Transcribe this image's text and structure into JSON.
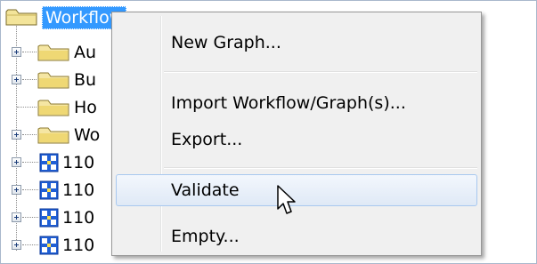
{
  "tree": {
    "root_label": "Workflow",
    "items": [
      {
        "label": "Au",
        "type": "folder",
        "expandable": true
      },
      {
        "label": "Bu",
        "type": "folder",
        "expandable": true
      },
      {
        "label": "Ho",
        "type": "folder",
        "expandable": false
      },
      {
        "label": "Wo",
        "type": "folder",
        "expandable": true
      },
      {
        "label": "110",
        "type": "graph",
        "expandable": true
      },
      {
        "label": "110",
        "type": "graph",
        "expandable": true
      },
      {
        "label": "110",
        "type": "graph",
        "expandable": true
      },
      {
        "label": "110",
        "type": "graph",
        "expandable": true
      }
    ],
    "icons": {
      "folder": "folder-icon",
      "graph": "graph-icon",
      "expander": "plus-expander-icon"
    }
  },
  "context_menu": {
    "items": [
      {
        "label": "New Graph..."
      },
      {
        "label": "Import Workflow/Graph(s)..."
      },
      {
        "label": "Export..."
      },
      {
        "label": "Validate",
        "hovered": true
      },
      {
        "label": "Empty..."
      }
    ]
  },
  "colors": {
    "selection": "#3399ff",
    "menu_background": "#f0f0f0",
    "hover_border": "#a8c8ef",
    "folder_fill": "#f5e6a3",
    "graph_fill": "#1f5fd6"
  }
}
